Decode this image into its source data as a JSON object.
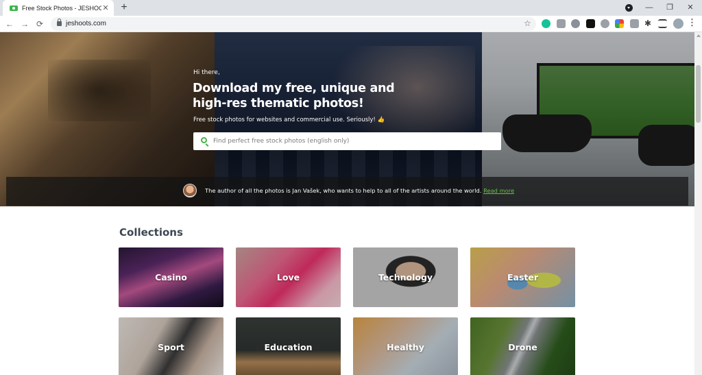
{
  "browser": {
    "tab_title": "Free Stock Photos - JESHOOTS.com",
    "tab_close": "✕",
    "new_tab": "+",
    "url": "jeshoots.com",
    "controls": {
      "minimize": "—",
      "restore": "❐",
      "close": "✕"
    },
    "nav": {
      "back": "←",
      "forward": "→",
      "reload": "⟳"
    },
    "star": "☆",
    "menu": "⋮"
  },
  "hero": {
    "greeting": "Hi there,",
    "title": "Download my free, unique and high-res thematic photos!",
    "subtitle": "Free stock photos for websites and commercial use. Seriously! 👍",
    "search_placeholder": "Find perfect free stock photos (english only)"
  },
  "author": {
    "text": "The author of all the photos is Jan Vašek, who wants to help to all of the artists around the world. ",
    "link": "Read more"
  },
  "collections": {
    "title": "Collections",
    "items": [
      {
        "label": "Casino"
      },
      {
        "label": "Love"
      },
      {
        "label": "Technology"
      },
      {
        "label": "Easter"
      },
      {
        "label": "Sport"
      },
      {
        "label": "Education"
      },
      {
        "label": "Healthy"
      },
      {
        "label": "Drone"
      }
    ]
  },
  "colors": {
    "accent": "#48b049",
    "link": "#6cc04a",
    "heading": "#3c4752"
  }
}
